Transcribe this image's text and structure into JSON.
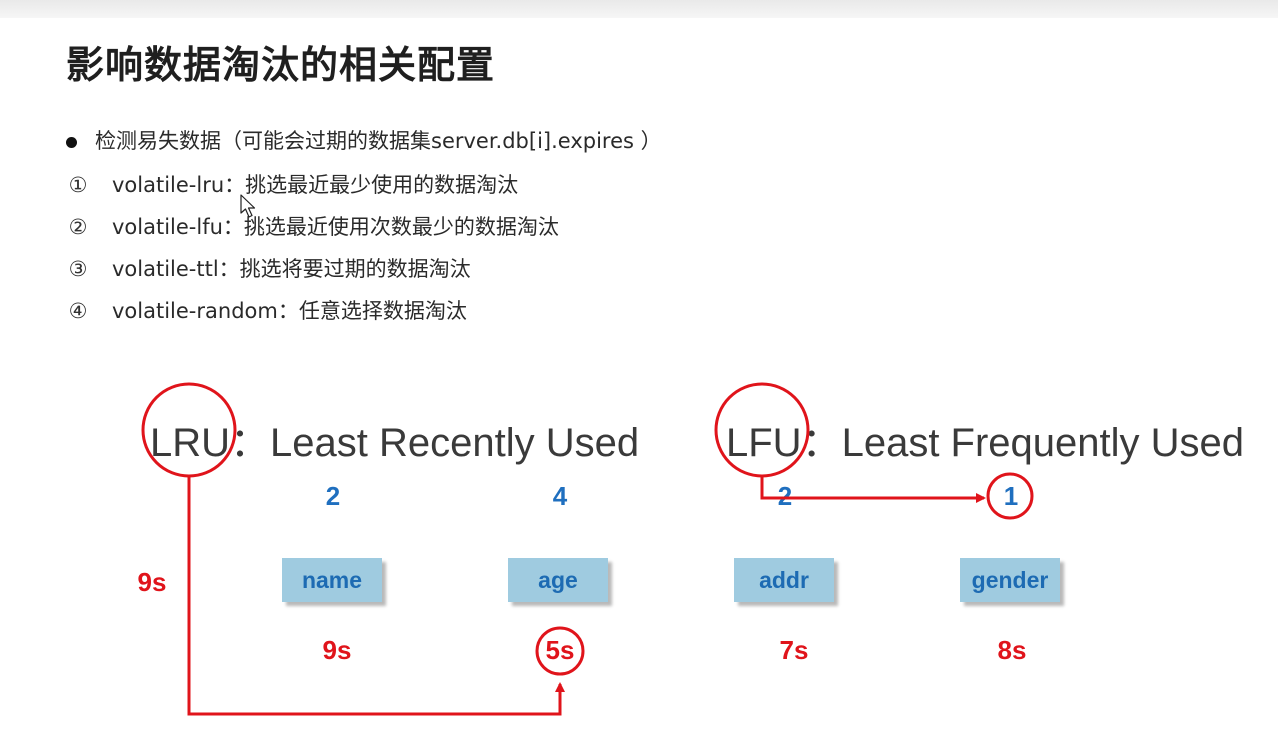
{
  "page": {
    "title": "影响数据淘汰的相关配置"
  },
  "bullets": {
    "intro": "检测易失数据（可能会过期的数据集server.db[i].expires ）",
    "items": [
      {
        "marker": "①",
        "text": "volatile-lru：挑选最近最少使用的数据淘汰"
      },
      {
        "marker": "②",
        "text": "volatile-lfu：挑选最近使用次数最少的数据淘汰"
      },
      {
        "marker": "③",
        "text": "volatile-ttl：挑选将要过期的数据淘汰"
      },
      {
        "marker": "④",
        "text": "volatile-random：任意选择数据淘汰"
      }
    ]
  },
  "diagram": {
    "lru": {
      "abbr": "LRU",
      "colon": "：",
      "full": "Least Recently Used"
    },
    "lfu": {
      "abbr": "LFU",
      "colon": "：",
      "full": "Least Frequently Used"
    },
    "left_time": "9s",
    "keys": [
      {
        "name": "name",
        "count": "2",
        "time": "9s"
      },
      {
        "name": "age",
        "count": "4",
        "time": "5s"
      },
      {
        "name": "addr",
        "count": "2",
        "time": "7s"
      },
      {
        "name": "gender",
        "count": "1",
        "time": "8s"
      }
    ],
    "colors": {
      "accent_red": "#e0141b",
      "key_blue": "#1f6fbf",
      "box_fill": "#9fcbe0"
    }
  }
}
